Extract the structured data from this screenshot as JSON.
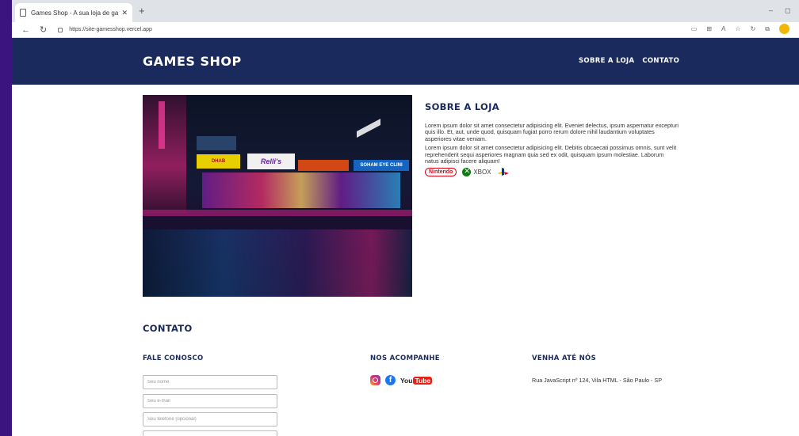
{
  "browser": {
    "tab_title": "Games Shop - A sua loja de gam",
    "tab_close": "✕",
    "new_tab": "+",
    "url": "https://site-gamesshop.vercel.app",
    "win_min": "–",
    "win_max": "◻"
  },
  "header": {
    "brand": "GAMES SHOP",
    "nav": [
      "SOBRE A LOJA",
      "CONTATO"
    ]
  },
  "about": {
    "title": "SOBRE A LOJA",
    "p1": "Lorem ipsum dolor sit amet consectetur adipisicing elit. Eveniet delectus, ipsum aspernatur excepturi quis illo. Et, aut, unde quod, quisquam fugiat porro rerum dolore nihil laudantium voluptates asperiores vitae veniam.",
    "p2": "Lorem ipsum dolor sit amet consectetur adipisicing elit. Debitis obcaecati possimus omnis, sunt velit reprehenderit sequi asperiores magnam quia sed ex odit, quisquam ipsum molestiae. Laborum natus adipisci facere aliquam!",
    "logos": {
      "nintendo": "Nintendo",
      "xbox": "XBOX"
    }
  },
  "hero_signs": [
    "Relli's",
    "SOHAM EYE CLINI",
    "DHAB"
  ],
  "contato": {
    "title": "CONTATO",
    "fale_conosco": "FALE CONOSCO",
    "nos_acompanhe": "NOS ACOMPANHE",
    "venha": "VENHA ATÉ NÓS",
    "placeholders": {
      "name": "Seu nome",
      "email": "Seu e-mail",
      "phone": "Seu telefone (opcional)"
    },
    "youtube": {
      "you": "You",
      "tube": "Tube"
    },
    "address": "Rua JavaScript nº 124, Vila HTML - São Paulo - SP"
  },
  "colors": {
    "header_bg": "#1b2a5c",
    "page_bg": "#3b1480",
    "nintendo_red": "#e60012",
    "xbox_green": "#107c10"
  }
}
